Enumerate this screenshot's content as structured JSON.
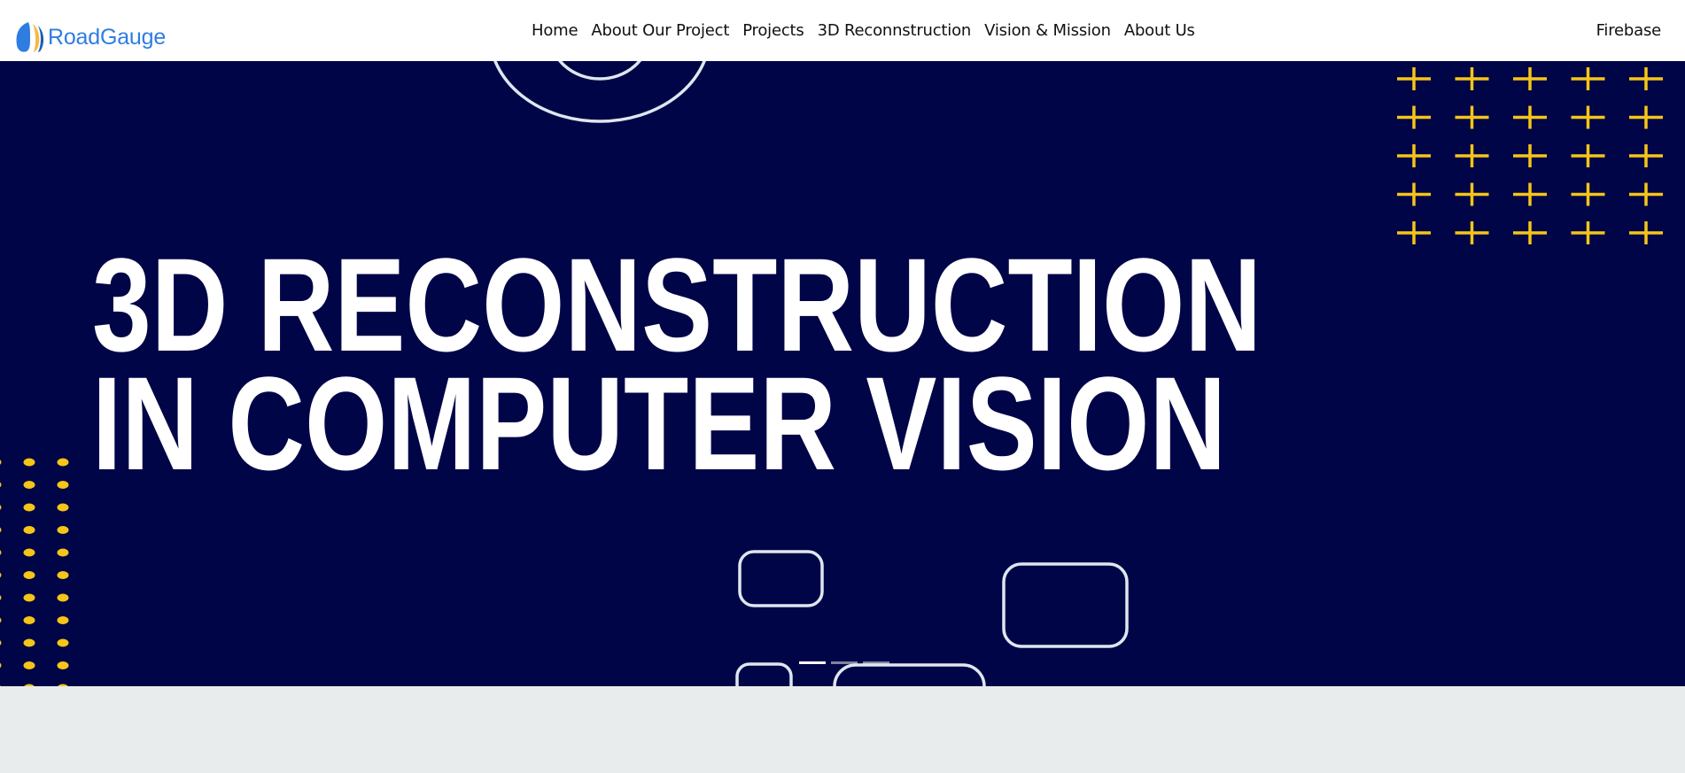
{
  "brand": {
    "name": "RoadGauge",
    "logo_icon": "roadgauge-logo-icon"
  },
  "nav": {
    "links": [
      {
        "label": "Home"
      },
      {
        "label": "About Our Project"
      },
      {
        "label": "Projects"
      },
      {
        "label": "3D Reconnstruction"
      },
      {
        "label": "Vision & Mission"
      },
      {
        "label": "About Us"
      }
    ],
    "right_link": "Firebase"
  },
  "hero": {
    "title_line1": "3D RECONSTRUCTION",
    "title_line2": "IN COMPUTER VISION",
    "slides_total": 3,
    "active_slide": 1
  },
  "colors": {
    "hero_background": "#000547",
    "accent_yellow": "#f5c518",
    "brand_blue": "#2f7de1",
    "page_background": "#e8ecec"
  }
}
